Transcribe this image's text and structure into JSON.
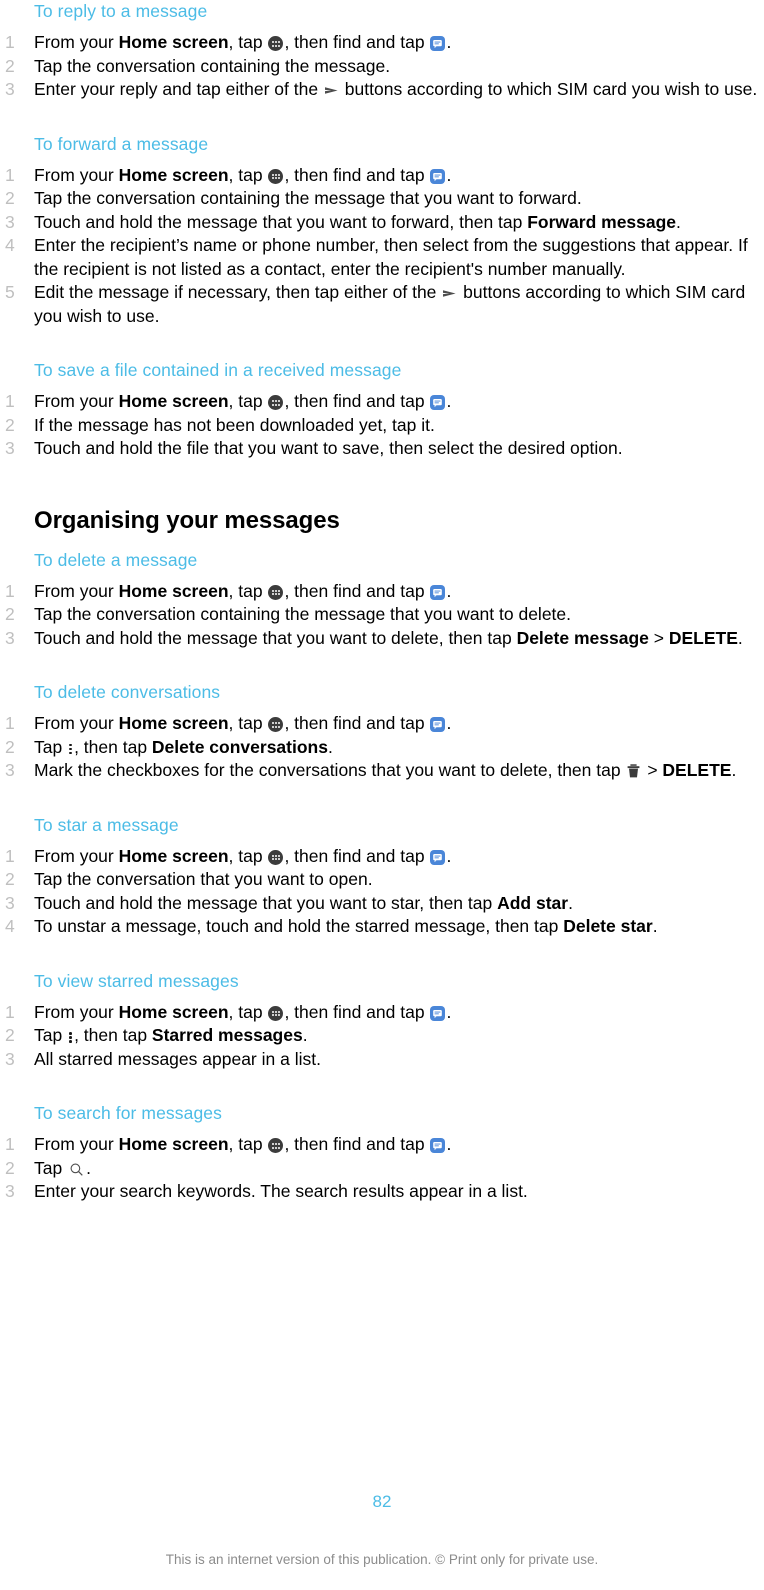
{
  "document": {
    "page_number": "82",
    "footer_note": "This is an internet version of this publication. © Print only for private use.",
    "accent_color": "#4cbce6",
    "number_color": "#bfbfbf",
    "messaging_icon_color": "#4a86d8",
    "appdrawer_icon_color": "#3c3c3c"
  },
  "icons": {
    "app_drawer": "app-drawer-icon",
    "messaging": "messaging-app-icon",
    "send": "send-arrow-icon",
    "overflow": "overflow-menu-icon",
    "trash": "trash-icon",
    "search": "search-icon"
  },
  "sections": {
    "reply": {
      "title": "To reply to a message",
      "steps": {
        "s1_a": "From your ",
        "s1_b": "Home screen",
        "s1_c": ", tap ",
        "s1_d": ", then find and tap ",
        "s1_e": ".",
        "s2": "Tap the conversation containing the message.",
        "s3_a": "Enter your reply and tap either of the ",
        "s3_b": " buttons according to which SIM card you wish to use."
      }
    },
    "forward": {
      "title": "To forward a message",
      "steps": {
        "s1_a": "From your ",
        "s1_b": "Home screen",
        "s1_c": ", tap ",
        "s1_d": ", then find and tap ",
        "s1_e": ".",
        "s2": "Tap the conversation containing the message that you want to forward.",
        "s3_a": "Touch and hold the message that you want to forward, then tap ",
        "s3_b": "Forward message",
        "s3_c": ".",
        "s4": "Enter the recipient’s name or phone number, then select from the suggestions that appear. If the recipient is not listed as a contact, enter the recipient's number manually.",
        "s5_a": "Edit the message if necessary, then tap either of the ",
        "s5_b": " buttons according to which SIM card you wish to use."
      }
    },
    "save_file": {
      "title": "To save a file contained in a received message",
      "steps": {
        "s1_a": "From your ",
        "s1_b": "Home screen",
        "s1_c": ", tap ",
        "s1_d": ", then find and tap ",
        "s1_e": ".",
        "s2": "If the message has not been downloaded yet, tap it.",
        "s3": "Touch and hold the file that you want to save, then select the desired option."
      }
    },
    "organising": {
      "heading": "Organising your messages"
    },
    "delete_message": {
      "title": "To delete a message",
      "steps": {
        "s1_a": "From your ",
        "s1_b": "Home screen",
        "s1_c": ", tap ",
        "s1_d": ", then find and tap ",
        "s1_e": ".",
        "s2": "Tap the conversation containing the message that you want to delete.",
        "s3_a": "Touch and hold the message that you want to delete, then tap ",
        "s3_b": "Delete message",
        "s3_c": " > ",
        "s3_d": "DELETE",
        "s3_e": "."
      }
    },
    "delete_conversations": {
      "title": "To delete conversations",
      "steps": {
        "s1_a": "From your ",
        "s1_b": "Home screen",
        "s1_c": ", tap ",
        "s1_d": ", then find and tap ",
        "s1_e": ".",
        "s2_a": "Tap ",
        "s2_b": ", then tap ",
        "s2_c": "Delete conversations",
        "s2_d": ".",
        "s3_a": "Mark the checkboxes for the conversations that you want to delete, then tap ",
        "s3_b": " > ",
        "s3_c": "DELETE",
        "s3_d": "."
      }
    },
    "star_message": {
      "title": "To star a message",
      "steps": {
        "s1_a": "From your ",
        "s1_b": "Home screen",
        "s1_c": ", tap ",
        "s1_d": ", then find and tap ",
        "s1_e": ".",
        "s2": "Tap the conversation that you want to open.",
        "s3_a": "Touch and hold the message that you want to star, then tap ",
        "s3_b": "Add star",
        "s3_c": ".",
        "s4_a": "To unstar a message, touch and hold the starred message, then tap ",
        "s4_b": "Delete star",
        "s4_c": "."
      }
    },
    "view_starred": {
      "title": "To view starred messages",
      "steps": {
        "s1_a": "From your ",
        "s1_b": "Home screen",
        "s1_c": ", tap ",
        "s1_d": ", then find and tap ",
        "s1_e": ".",
        "s2_a": "Tap ",
        "s2_b": ", then tap ",
        "s2_c": "Starred messages",
        "s2_d": ".",
        "s3": "All starred messages appear in a list."
      }
    },
    "search_messages": {
      "title": "To search for messages",
      "steps": {
        "s1_a": "From your ",
        "s1_b": "Home screen",
        "s1_c": ", tap ",
        "s1_d": ", then find and tap ",
        "s1_e": ".",
        "s2_a": "Tap ",
        "s2_b": ".",
        "s3": "Enter your search keywords. The search results appear in a list."
      }
    }
  }
}
